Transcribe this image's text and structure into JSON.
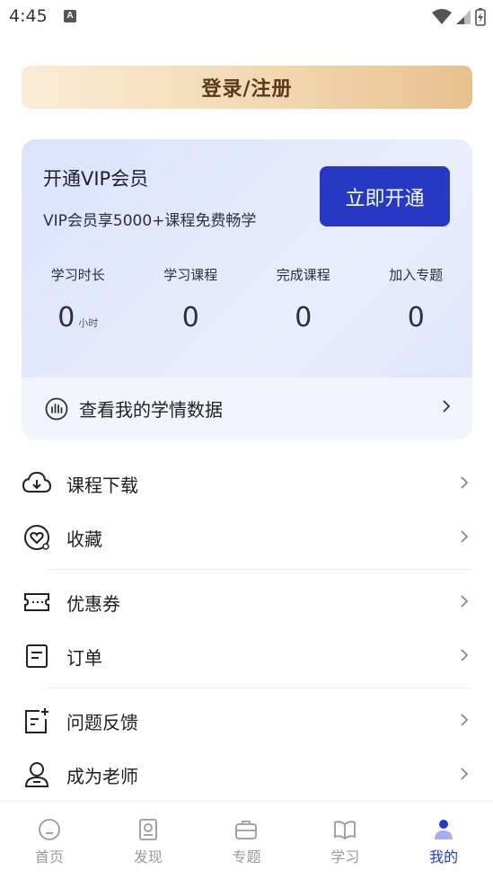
{
  "status": {
    "time": "4:45",
    "a_label": "A"
  },
  "login": {
    "label": "登录/注册"
  },
  "vip": {
    "title": "开通VIP会员",
    "subtitle": "VIP会员享5000+课程免费畅学",
    "button": "立即开通",
    "stats": [
      {
        "label": "学习时长",
        "value": "0",
        "unit": "小时"
      },
      {
        "label": "学习课程",
        "value": "0",
        "unit": ""
      },
      {
        "label": "完成课程",
        "value": "0",
        "unit": ""
      },
      {
        "label": "加入专题",
        "value": "0",
        "unit": ""
      }
    ],
    "study_data_label": "查看我的学情数据"
  },
  "menu": {
    "items": [
      {
        "label": "课程下载",
        "icon": "cloud-download-icon"
      },
      {
        "label": "收藏",
        "icon": "heart-icon"
      },
      {
        "label": "优惠券",
        "icon": "ticket-icon"
      },
      {
        "label": "订单",
        "icon": "order-icon"
      },
      {
        "label": "问题反馈",
        "icon": "feedback-icon"
      },
      {
        "label": "成为老师",
        "icon": "teacher-icon"
      }
    ]
  },
  "nav": {
    "items": [
      {
        "label": "首页",
        "icon": "home-icon"
      },
      {
        "label": "发现",
        "icon": "discover-icon"
      },
      {
        "label": "专题",
        "icon": "topic-icon"
      },
      {
        "label": "学习",
        "icon": "study-icon"
      },
      {
        "label": "我的",
        "icon": "profile-icon",
        "active": true
      }
    ]
  },
  "colors": {
    "accent": "#2638c4",
    "gold_text": "#5a3a1a"
  }
}
